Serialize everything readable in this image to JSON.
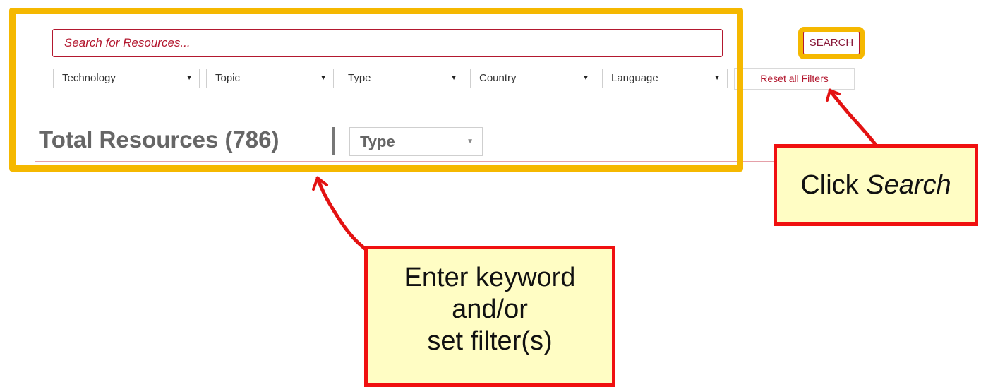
{
  "search": {
    "placeholder": "Search for Resources...",
    "button_label": "SEARCH"
  },
  "filters": [
    {
      "label": "Technology"
    },
    {
      "label": "Topic"
    },
    {
      "label": "Type"
    },
    {
      "label": "Country"
    },
    {
      "label": "Language"
    }
  ],
  "reset_label": "Reset all Filters",
  "results": {
    "total_text": "Total Resources (786)",
    "sort_select": "Type"
  },
  "annotations": {
    "click_search_prefix": "Click ",
    "click_search_emphasis": "Search",
    "enter_keyword_lines": [
      "Enter keyword",
      "and/or",
      "set filter(s)"
    ],
    "highlight_color": "#f5b800",
    "callout_border_color": "#f01010",
    "callout_fill_color": "#fffdc4"
  },
  "colors": {
    "accent": "#b3182f"
  }
}
